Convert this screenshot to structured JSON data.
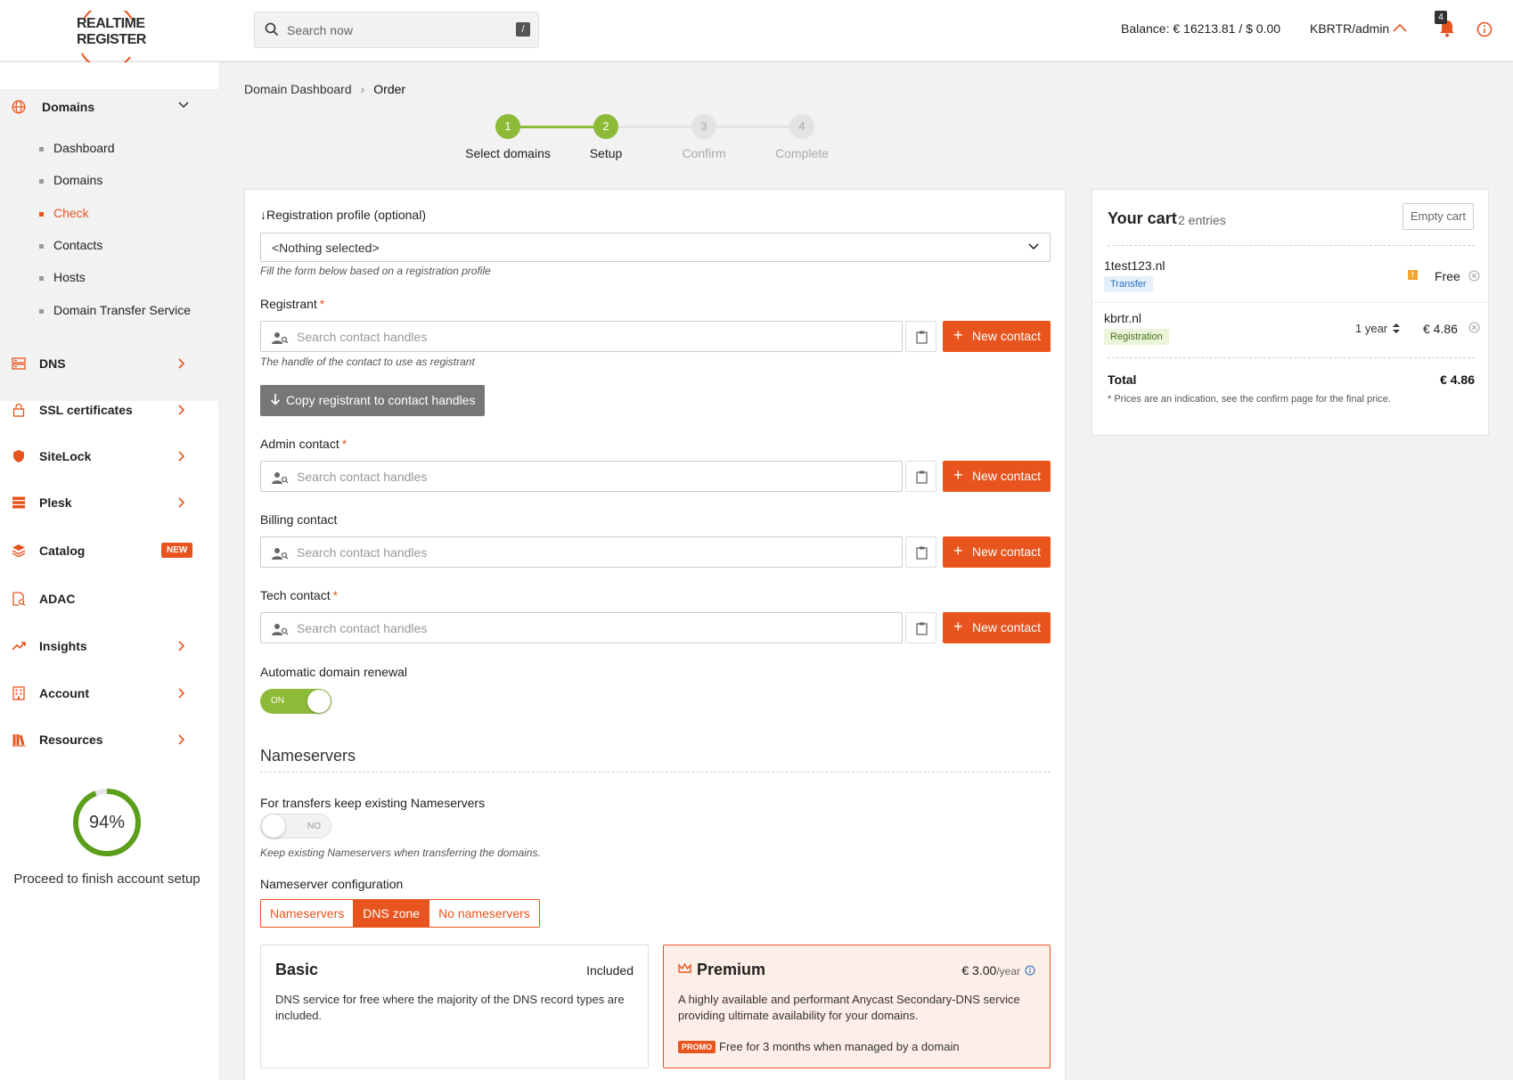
{
  "header": {
    "logo_line1": "REALTIME",
    "logo_line2": "REGISTER",
    "search_placeholder": "Search now",
    "search_shortcut": "/",
    "balance": "Balance: € 16213.81 / $ 0.00",
    "user": "KBRTR/admin",
    "notification_count": "4",
    "accent_color": "#e8541e"
  },
  "sidebar": {
    "domains": {
      "label": "Domains",
      "items": [
        {
          "label": "Dashboard",
          "active": false
        },
        {
          "label": "Domains",
          "active": false
        },
        {
          "label": "Check",
          "active": true
        },
        {
          "label": "Contacts",
          "active": false
        },
        {
          "label": "Hosts",
          "active": false
        },
        {
          "label": "Domain Transfer Service",
          "active": false
        }
      ]
    },
    "items": [
      {
        "label": "DNS",
        "icon": "server-icon"
      },
      {
        "label": "SSL certificates",
        "icon": "lock-icon"
      },
      {
        "label": "SiteLock",
        "icon": "shield-icon"
      },
      {
        "label": "Plesk",
        "icon": "stack-icon"
      },
      {
        "label": "Catalog",
        "icon": "layers-icon",
        "badge": "NEW"
      },
      {
        "label": "ADAC",
        "icon": "document-search-icon"
      },
      {
        "label": "Insights",
        "icon": "trend-icon"
      },
      {
        "label": "Account",
        "icon": "building-icon"
      },
      {
        "label": "Resources",
        "icon": "books-icon"
      }
    ],
    "setup_progress": "94%",
    "setup_progress_value": 0.94,
    "setup_label": "Proceed to finish account setup"
  },
  "breadcrumb": {
    "parent": "Domain Dashboard",
    "current": "Order"
  },
  "steps": [
    {
      "num": "1",
      "label": "Select domains",
      "state": "done"
    },
    {
      "num": "2",
      "label": "Setup",
      "state": "done"
    },
    {
      "num": "3",
      "label": "Confirm",
      "state": "todo"
    },
    {
      "num": "4",
      "label": "Complete",
      "state": "todo"
    }
  ],
  "form": {
    "profile_label": "Registration profile (optional)",
    "profile_value": "<Nothing selected>",
    "profile_hint": "Fill the form below based on a registration profile",
    "registrant_label": "Registrant",
    "registrant_hint": "The handle of the contact to use as registrant",
    "contact_placeholder": "Search contact handles",
    "new_contact": "New contact",
    "copy_button": "Copy registrant to contact handles",
    "admin_label": "Admin contact",
    "billing_label": "Billing contact",
    "tech_label": "Tech contact",
    "required_mark": "*",
    "renewal_label": "Automatic domain renewal",
    "renewal_state": "ON",
    "nameservers_title": "Nameservers",
    "keep_ns_label": "For transfers keep existing Nameservers",
    "keep_ns_state": "NO",
    "keep_ns_hint": "Keep existing Nameservers when transferring the domains.",
    "ns_config_label": "Nameserver configuration",
    "ns_options": [
      {
        "label": "Nameservers",
        "active": false
      },
      {
        "label": "DNS zone",
        "active": true
      },
      {
        "label": "No nameservers",
        "active": false
      }
    ]
  },
  "plans": {
    "basic": {
      "title": "Basic",
      "price": "Included",
      "desc": "DNS service for free where the majority of the DNS record types are included."
    },
    "premium": {
      "title": "Premium",
      "price": "€ 3.00",
      "per": "/year",
      "desc": "A highly available and performant Anycast Secondary-DNS service providing ultimate availability for your domains.",
      "promo_tag": "PROMO",
      "promo_text": "Free for 3 months when managed by a domain"
    }
  },
  "cart": {
    "title": "Your cart",
    "count": "2 entries",
    "empty_button": "Empty cart",
    "items": [
      {
        "name": "1test123.nl",
        "type": "Transfer",
        "price": "Free",
        "period": ""
      },
      {
        "name": "kbrtr.nl",
        "type": "Registration",
        "price": "€ 4.86",
        "period": "1 year"
      }
    ],
    "total_label": "Total",
    "total_value": "€ 4.86",
    "note": "* Prices are an indication, see the confirm page for the final price."
  }
}
